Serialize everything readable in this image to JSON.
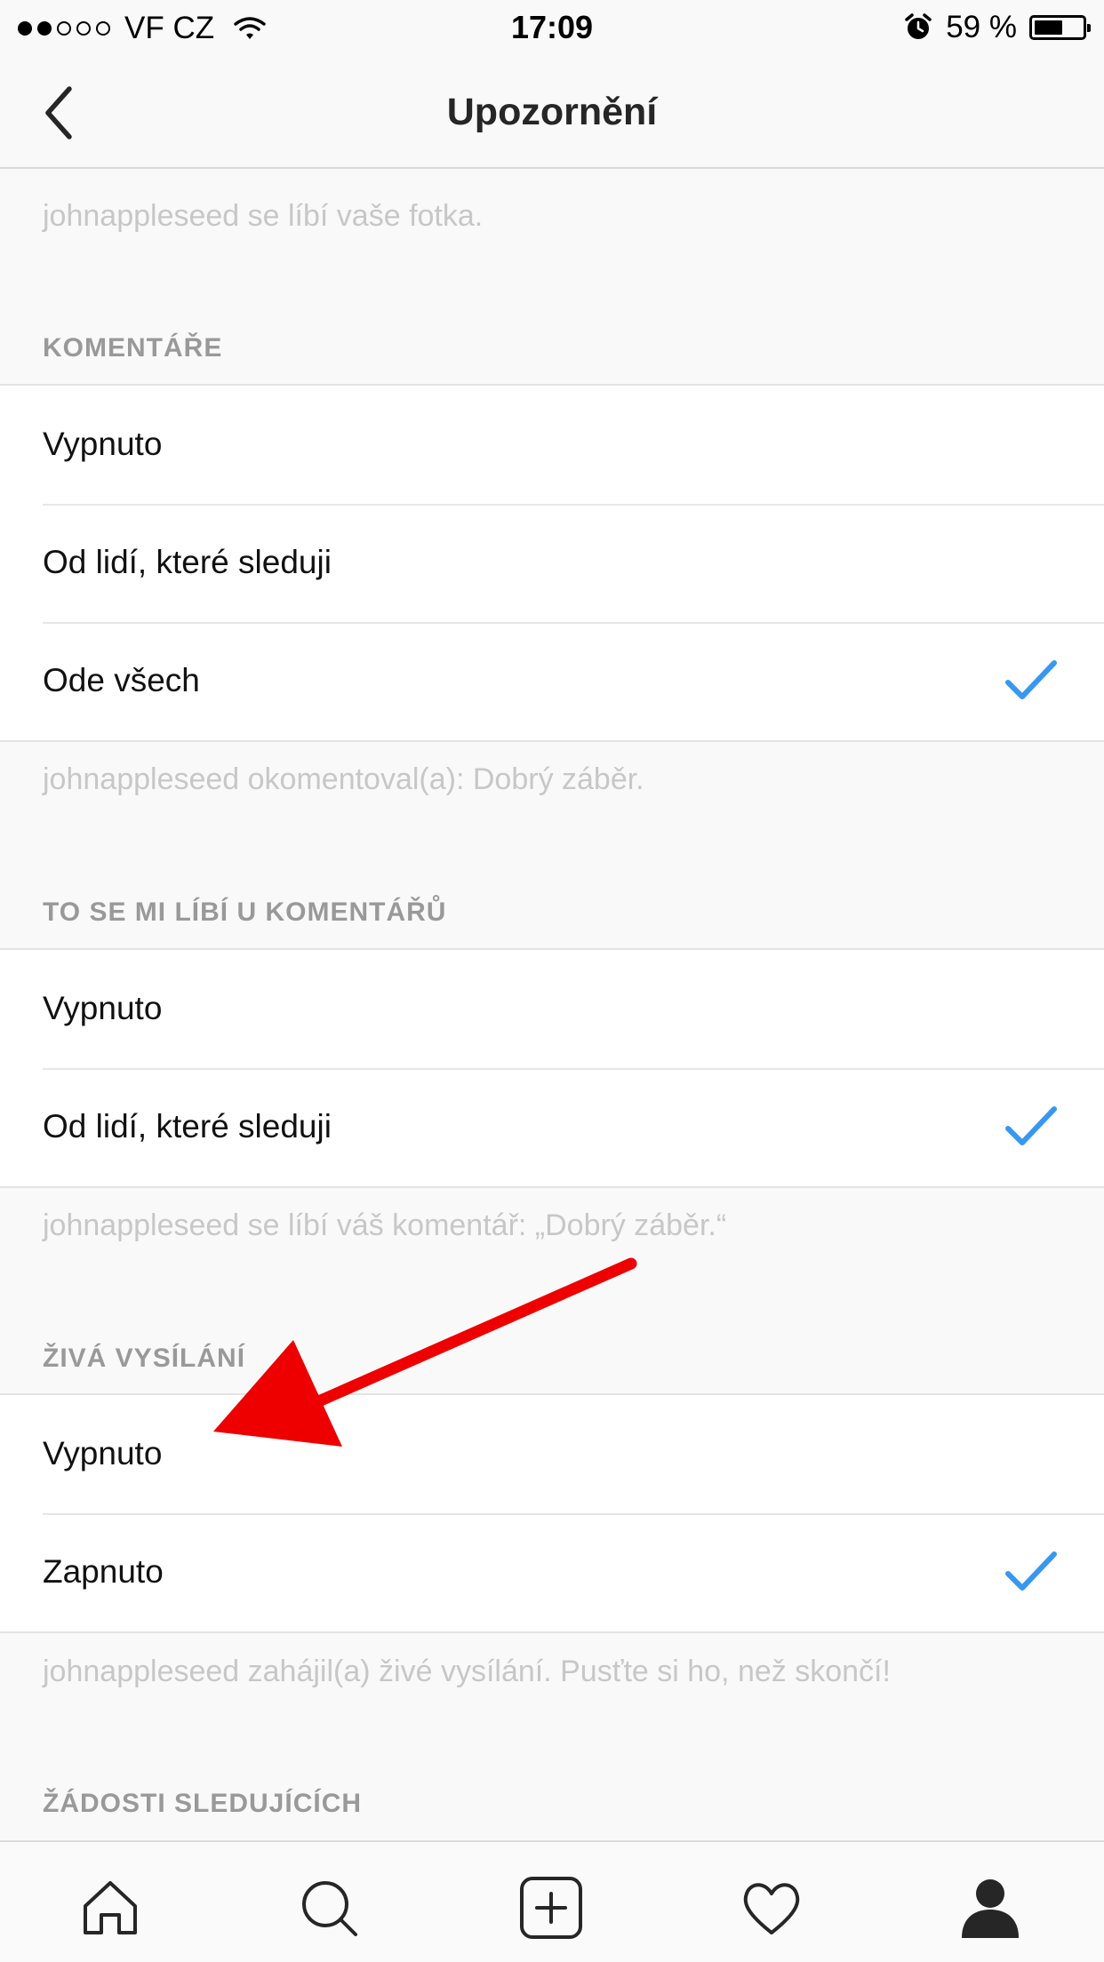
{
  "status_bar": {
    "carrier": "VF CZ",
    "signal_bars_filled": 2,
    "signal_bars_total": 5,
    "time": "17:09",
    "battery": "59 %",
    "battery_level": 0.59,
    "icons": [
      "wifi-icon",
      "alarm-icon",
      "battery-icon"
    ]
  },
  "nav": {
    "title": "Upozornění",
    "back_icon": "chevron-left-icon"
  },
  "sections": {
    "likes_note": "johnappleseed se líbí vaše fotka.",
    "comments": {
      "header": "KOMENTÁŘE",
      "options": [
        "Vypnuto",
        "Od lidí, které sleduji",
        "Ode všech"
      ],
      "selected": "Ode všech",
      "note": "johnappleseed okomentoval(a): Dobrý záběr."
    },
    "comment_likes": {
      "header": "TO SE MI LÍBÍ U KOMENTÁŘŮ",
      "options": [
        "Vypnuto",
        "Od lidí, které sleduji"
      ],
      "selected": "Od lidí, které sleduji",
      "note": "johnappleseed se líbí váš komentář: „Dobrý záběr.“"
    },
    "live": {
      "header": "ŽIVÁ VYSÍLÁNÍ",
      "options": [
        "Vypnuto",
        "Zapnuto"
      ],
      "selected": "Zapnuto",
      "note": "johnappleseed zahájil(a) živé vysílání. Pusťte si ho, než skončí!"
    },
    "follow_requests": {
      "header": "ŽÁDOSTI SLEDUJÍCÍCH"
    }
  },
  "tab_bar": {
    "tabs": [
      "home-icon",
      "search-icon",
      "add-post-icon",
      "activity-heart-icon",
      "profile-icon"
    ],
    "active": "profile-icon"
  },
  "colors": {
    "checkmark": "#3897f0",
    "annotation_arrow": "#ee0000",
    "header_text": "#999999",
    "note_text": "#c7c7c7"
  }
}
